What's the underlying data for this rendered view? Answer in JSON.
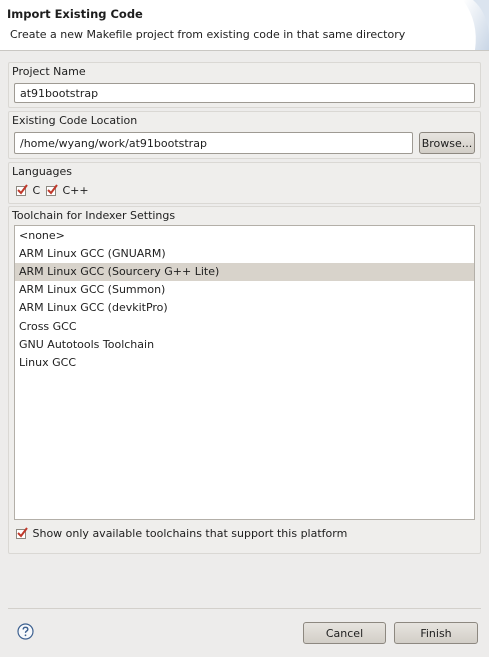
{
  "banner": {
    "title": "Import Existing Code",
    "description": "Create a new Makefile project from existing code in that same directory"
  },
  "project_name": {
    "label": "Project Name",
    "value": "at91bootstrap"
  },
  "code_location": {
    "label": "Existing Code Location",
    "value": "/home/wyang/work/at91bootstrap",
    "browse_label": "Browse..."
  },
  "languages": {
    "label": "Languages",
    "c_label": "C",
    "c_checked": true,
    "cpp_label": "C++",
    "cpp_checked": true
  },
  "toolchain": {
    "label": "Toolchain for Indexer Settings",
    "items": [
      "<none>",
      "ARM Linux GCC (GNUARM)",
      "ARM Linux GCC (Sourcery G++ Lite)",
      "ARM Linux GCC (Summon)",
      "ARM Linux GCC (devkitPro)",
      "Cross GCC",
      "GNU Autotools Toolchain",
      "Linux GCC"
    ],
    "selected": "ARM Linux GCC (Sourcery G++ Lite)",
    "show_only_label": "Show only available toolchains that support this platform",
    "show_only_checked": true
  },
  "footer": {
    "help_icon": "help-icon",
    "cancel_label": "Cancel",
    "finish_label": "Finish"
  },
  "colors": {
    "background": "#edeceb",
    "selection": "#d8d3cb",
    "check": "#c0392b"
  }
}
